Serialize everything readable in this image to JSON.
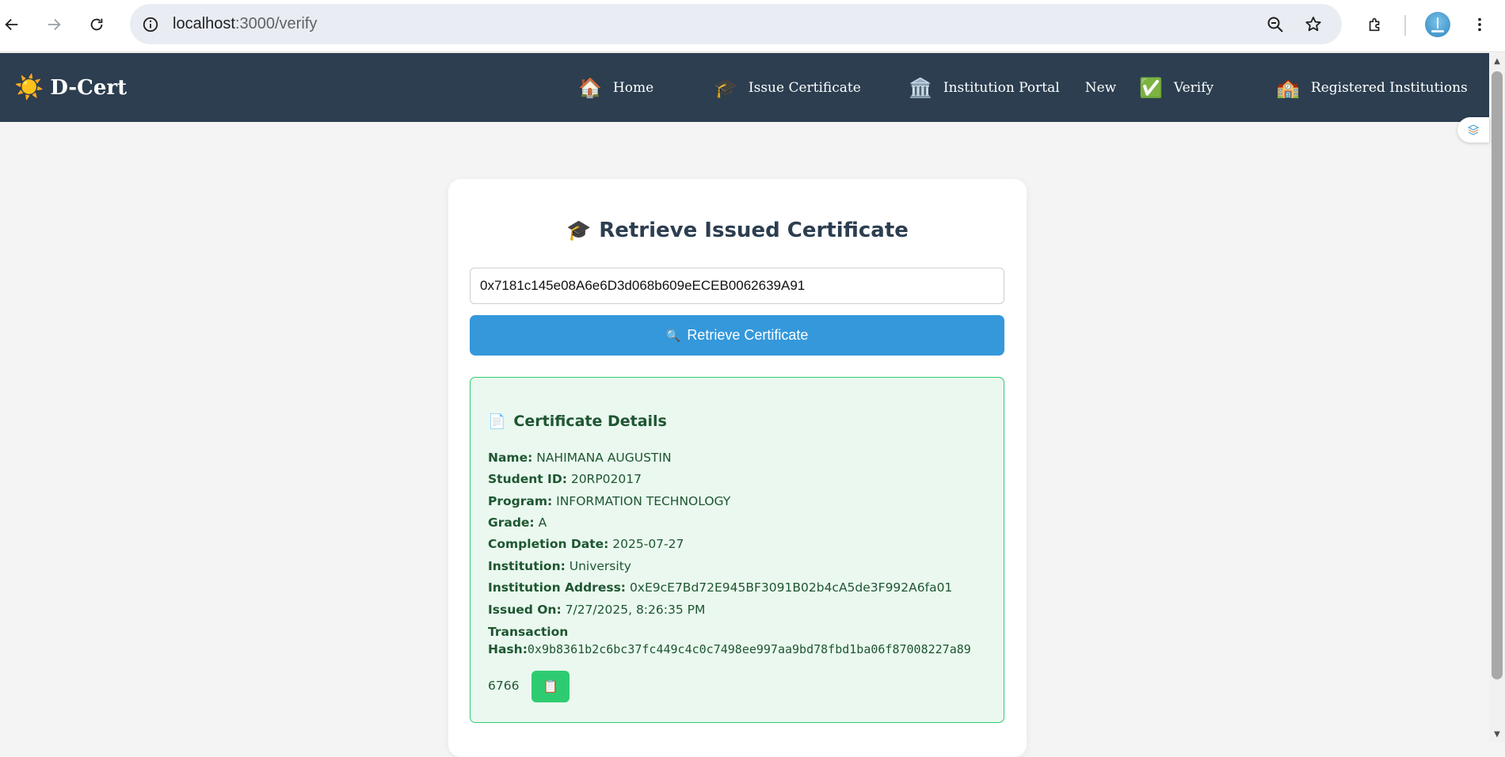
{
  "browser": {
    "url_host": "localhost",
    "url_path": ":3000/verify",
    "icons": [
      "back-arrow-icon",
      "forward-arrow-icon",
      "reload-icon",
      "site-info-icon",
      "zoom-out-icon",
      "bookmark-star-icon",
      "extensions-puzzle-icon",
      "profile-avatar-icon",
      "browser-menu-icon"
    ]
  },
  "navbar": {
    "brand": "D-Cert",
    "brand_icon": "☀️",
    "items": [
      {
        "icon": "🏠",
        "label": "Home"
      },
      {
        "icon": "🎓",
        "label": "Issue Certificate"
      },
      {
        "icon": "🏛️",
        "label": "Institution Portal",
        "badge": "New"
      },
      {
        "icon": "✅",
        "label": "Verify"
      },
      {
        "icon": "🏫",
        "label": "Registered Institutions"
      }
    ],
    "background": "#2c3e50"
  },
  "main": {
    "title_icon": "🎓",
    "title": "Retrieve Issued Certificate",
    "address_input_value": "0x7181c145e08A6e6D3d068b609eECEB0062639A91",
    "retrieve_button_icon": "🔍",
    "retrieve_button_label": "Retrieve Certificate",
    "details": {
      "title_icon": "📄",
      "title": "Certificate Details",
      "name_label": "Name:",
      "name_value": "NAHIMANA AUGUSTIN",
      "student_id_label": "Student ID:",
      "student_id_value": "20RP02017",
      "program_label": "Program:",
      "program_value": "INFORMATION TECHNOLOGY",
      "grade_label": "Grade:",
      "grade_value": "A",
      "completion_label": "Completion Date:",
      "completion_value": "2025-07-27",
      "institution_label": "Institution:",
      "institution_value": "University",
      "institution_address_label": "Institution Address:",
      "institution_address_value": "0xE9cE7Bd72E945BF3091B02b4cA5de3F992A6fa01",
      "issued_on_label": "Issued On:",
      "issued_on_value": "7/27/2025, 8:26:35 PM",
      "tx_label_line1": "Transaction",
      "tx_label_line2": "Hash:",
      "tx_hash_part1": "0x9b8361b2c6bc37fc449c4c0c7498ee997aa9bd78fbd1ba06f87008227a89",
      "tx_hash_part2": "6766",
      "copy_icon": "📋"
    },
    "accent_blue": "#3498db",
    "accent_green": "#2ecc71"
  }
}
